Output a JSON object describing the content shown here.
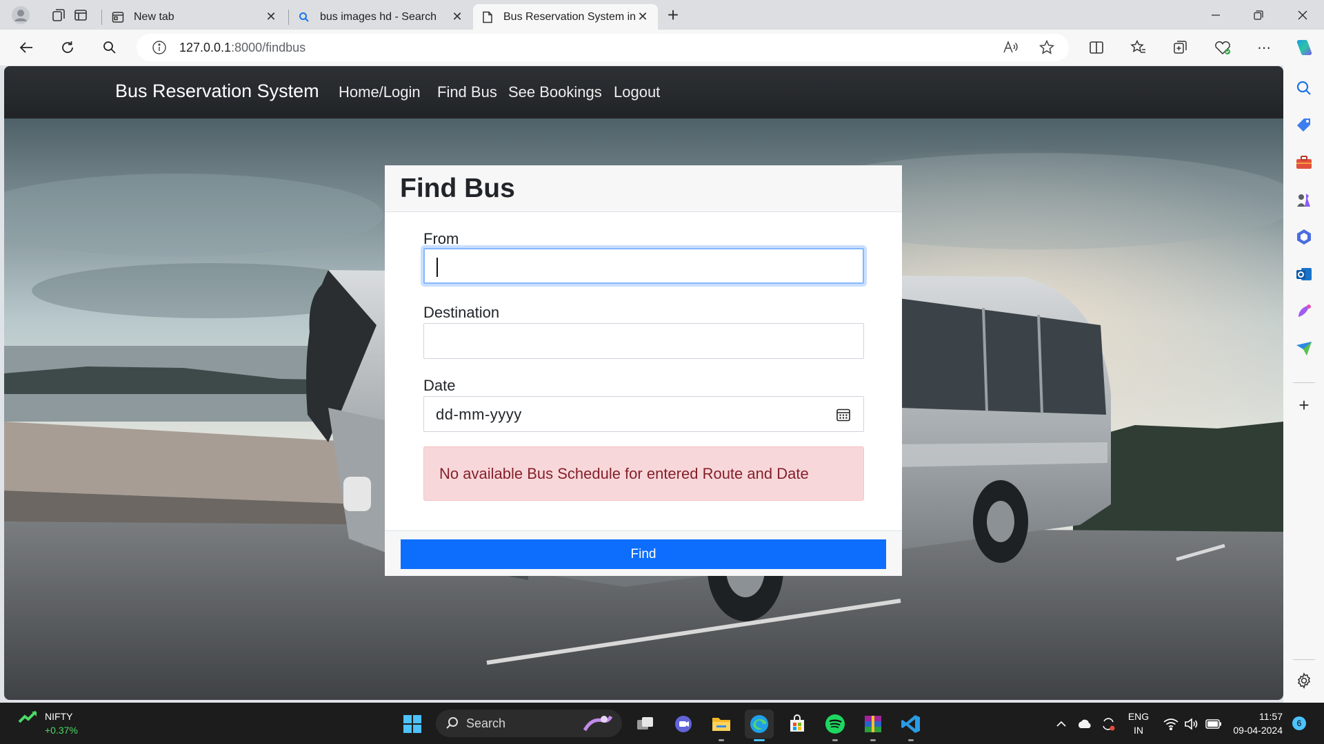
{
  "browser": {
    "tabs": [
      {
        "title": "New tab",
        "active": false
      },
      {
        "title": "bus images hd - Search",
        "active": false
      },
      {
        "title": "Bus Reservation System in Django",
        "active": true
      }
    ],
    "new_tab_symbol": "+",
    "address": {
      "host": "127.0.0.1",
      "path": ":8000/findbus"
    }
  },
  "navbar": {
    "brand": "Bus Reservation System",
    "links": [
      "Home/Login",
      "Find Bus",
      "See Bookings",
      "Logout"
    ]
  },
  "card": {
    "title": "Find Bus",
    "from_label": "From",
    "from_value": "",
    "destination_label": "Destination",
    "destination_value": "",
    "date_label": "Date",
    "date_placeholder": "dd-mm-yyyy",
    "alert": "No available Bus Schedule for entered Route and Date",
    "button": "Find"
  },
  "taskbar": {
    "stock_name": "NIFTY",
    "stock_change": "+0.37%",
    "search_label": "Search",
    "lang_top": "ENG",
    "lang_bottom": "IN",
    "time": "11:57",
    "date": "09-04-2024",
    "notification_count": "6"
  },
  "colors": {
    "navbar": "#212529",
    "primary": "#0d6efd",
    "alert_bg": "#f8d7da",
    "alert_text": "#842029"
  }
}
